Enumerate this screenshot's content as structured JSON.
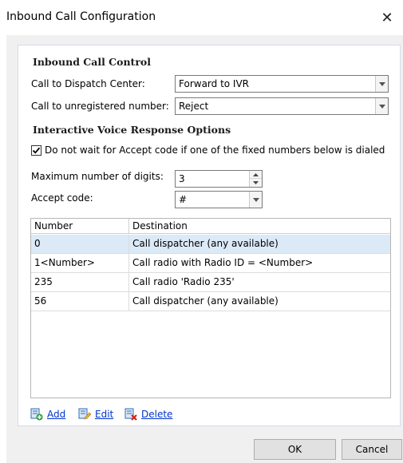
{
  "window": {
    "title": "Inbound Call Configuration",
    "close_glyph": "✕"
  },
  "inbound_call_control": {
    "heading": "Inbound Call Control",
    "dispatch_label": "Call to Dispatch Center:",
    "dispatch_value": "Forward to IVR",
    "unregistered_label": "Call to unregistered number:",
    "unregistered_value": "Reject"
  },
  "ivr": {
    "heading": "Interactive Voice Response Options",
    "no_wait_checked": true,
    "no_wait_label": "Do not wait for Accept code if one of the fixed numbers below is dialed",
    "max_digits_label": "Maximum number of digits:",
    "max_digits_value": "3",
    "accept_code_label": "Accept code:",
    "accept_code_value": "#"
  },
  "table": {
    "columns": [
      "Number",
      "Destination"
    ],
    "rows": [
      {
        "number": "0",
        "destination": "Call dispatcher (any available)"
      },
      {
        "number": "1<Number>",
        "destination": "Call radio with Radio ID = <Number>"
      },
      {
        "number": "235",
        "destination": "Call radio 'Radio 235'"
      },
      {
        "number": "56",
        "destination": "Call dispatcher (any available)"
      }
    ],
    "selected_index": 0
  },
  "actions": {
    "add": "Add",
    "edit": "Edit",
    "delete": "Delete"
  },
  "buttons": {
    "ok": "OK",
    "cancel": "Cancel"
  },
  "colors": {
    "link": "#0033cc",
    "selection": "#dce9f7",
    "icon_blue": "#2f6db5",
    "add_green": "#2a9d3a",
    "delete_red": "#d42020"
  }
}
